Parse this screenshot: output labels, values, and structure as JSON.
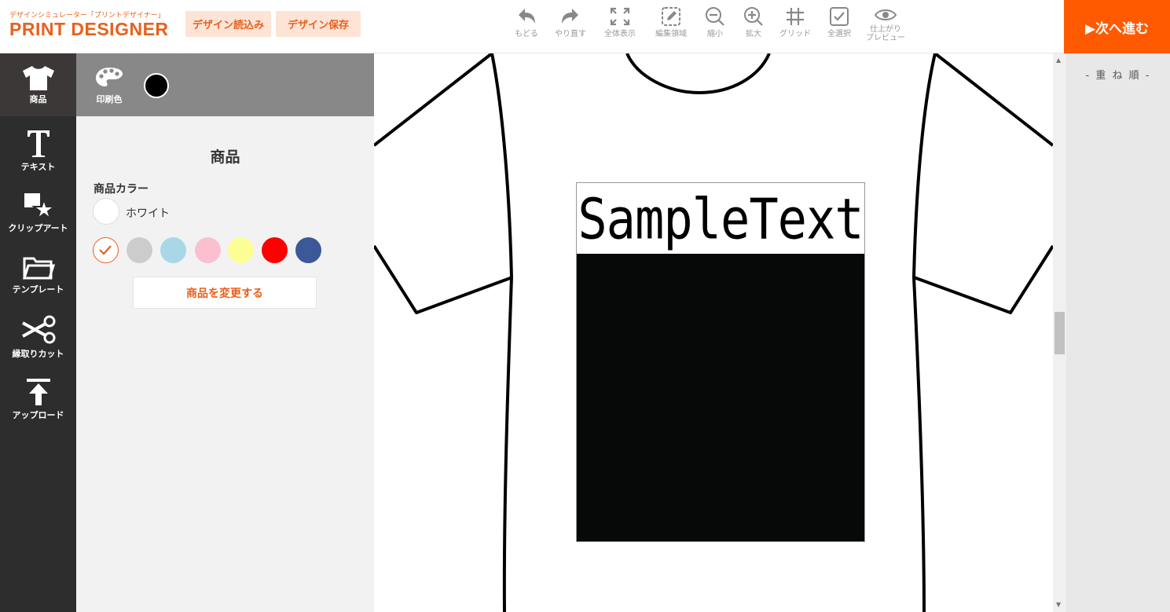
{
  "header": {
    "logo_sub": "デザインシミュレーター「プリントデザイナー」",
    "logo_main": "PRINT DESIGNER",
    "load_button": "デザイン読込み",
    "save_button": "デザイン保存",
    "tools": [
      {
        "label": "もどる",
        "icon": "undo-icon"
      },
      {
        "label": "やり直す",
        "icon": "redo-icon"
      },
      {
        "label": "全体表示",
        "icon": "fullscreen-icon"
      },
      {
        "label": "編集領域",
        "icon": "edit-area-icon"
      },
      {
        "label": "縮小",
        "icon": "zoom-out-icon"
      },
      {
        "label": "拡大",
        "icon": "zoom-in-icon"
      },
      {
        "label": "グリッド",
        "icon": "grid-icon"
      },
      {
        "label": "全選択",
        "icon": "select-all-icon"
      },
      {
        "label_line1": "仕上がり",
        "label_line2": "プレビュー",
        "icon": "eye-icon"
      }
    ],
    "next_button": "▶次へ進む"
  },
  "nav": {
    "items": [
      {
        "label": "商品",
        "icon": "tshirt-icon",
        "active": true
      },
      {
        "label": "テキスト",
        "icon": "text-icon"
      },
      {
        "label": "クリップアート",
        "icon": "clipart-icon"
      },
      {
        "label": "テンプレート",
        "icon": "folder-icon"
      },
      {
        "label": "縁取りカット",
        "icon": "scissors-icon"
      },
      {
        "label": "アップロード",
        "icon": "upload-icon"
      }
    ]
  },
  "panel": {
    "print_color_label": "印刷色",
    "print_color": "#000000",
    "title": "商品",
    "color_label": "商品カラー",
    "selected_color_name": "ホワイト",
    "selected_color": "#ffffff",
    "swatches": [
      "#ffffff",
      "#cccccc",
      "#a8d8e8",
      "#fbbfd0",
      "#fdfd96",
      "#ff0000",
      "#3b5998"
    ],
    "change_button": "商品を変更する"
  },
  "canvas": {
    "sample_text": "SampleText"
  },
  "right_panel": {
    "layer_title": "- 重 ね 順 -"
  }
}
